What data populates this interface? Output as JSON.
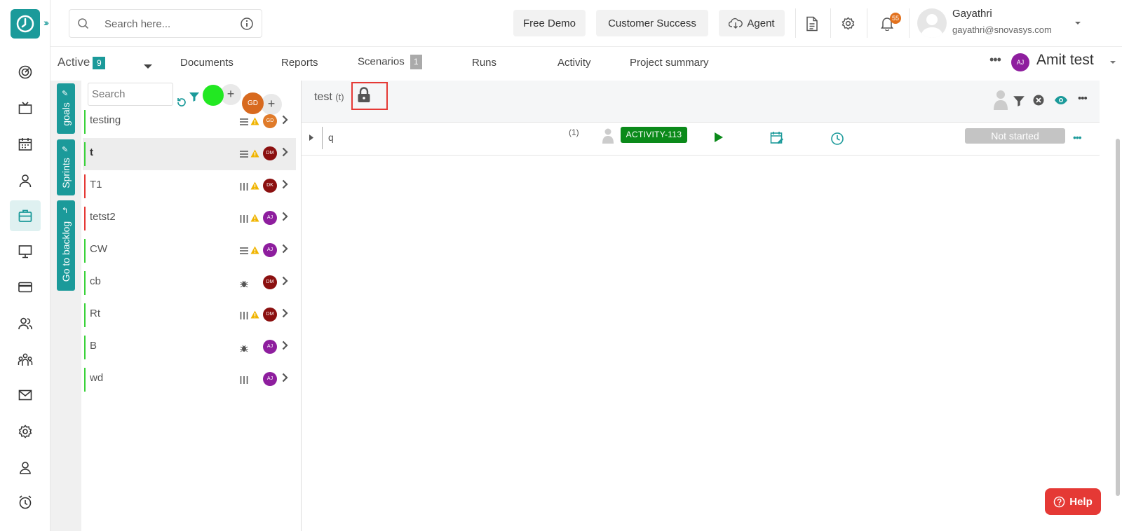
{
  "colors": {
    "accent": "#1b9a9a",
    "danger": "#e53935",
    "success": "#0b8a1a",
    "warning": "#f0b400"
  },
  "topbar": {
    "search_placeholder": "Search here...",
    "free_demo": "Free Demo",
    "customer_success": "Customer Success",
    "agent": "Agent",
    "notification_count": "55",
    "user_name": "Gayathri",
    "user_email": "gayathri@snovasys.com"
  },
  "subnav": {
    "status": "Active",
    "status_count": "9",
    "tabs": [
      "Documents",
      "Reports",
      "Scenarios",
      "Runs",
      "Activity",
      "Project summary"
    ],
    "scenarios_count": "1",
    "project_initials": "AJ",
    "project_name": "Amit test"
  },
  "side_tabs": [
    "goals",
    "Sprints",
    "Go to backlog"
  ],
  "list": {
    "search_placeholder": "Search",
    "header_avatar": "GD",
    "items": [
      {
        "label": "testing",
        "icon": "list-icon",
        "avatar": "GD",
        "avatar_color": "#e07b2a",
        "bar": "#3ad23a",
        "warn": true
      },
      {
        "label": "t",
        "icon": "list-icon",
        "avatar": "DM",
        "avatar_color": "#8b1010",
        "bar": "#3ad23a",
        "warn": true
      },
      {
        "label": "T1",
        "icon": "bars-icon",
        "avatar": "DK",
        "avatar_color": "#8b1010",
        "bar": "#e53935",
        "warn": true
      },
      {
        "label": "tetst2",
        "icon": "bars-icon",
        "avatar": "AJ",
        "avatar_color": "#8e1e9e",
        "bar": "#e53935",
        "warn": true
      },
      {
        "label": "CW",
        "icon": "list-icon",
        "avatar": "AJ",
        "avatar_color": "#8e1e9e",
        "bar": "#3ad23a",
        "warn": true
      },
      {
        "label": "cb",
        "icon": "bug-icon",
        "avatar": "DM",
        "avatar_color": "#8b1010",
        "bar": "#3ad23a",
        "warn": false
      },
      {
        "label": "Rt",
        "icon": "bars-icon",
        "avatar": "DM",
        "avatar_color": "#8b1010",
        "bar": "#3ad23a",
        "warn": true
      },
      {
        "label": "B",
        "icon": "bug-icon",
        "avatar": "AJ",
        "avatar_color": "#8e1e9e",
        "bar": "#3ad23a",
        "warn": false
      },
      {
        "label": "wd",
        "icon": "bars-icon",
        "avatar": "AJ",
        "avatar_color": "#8e1e9e",
        "bar": "#3ad23a",
        "warn": false
      }
    ]
  },
  "main": {
    "title": "test",
    "title_suffix": "(t)",
    "task": {
      "name": "q",
      "count": "(1)",
      "activity_id": "ACTIVITY-113",
      "status": "Not started"
    }
  },
  "help_label": "Help"
}
